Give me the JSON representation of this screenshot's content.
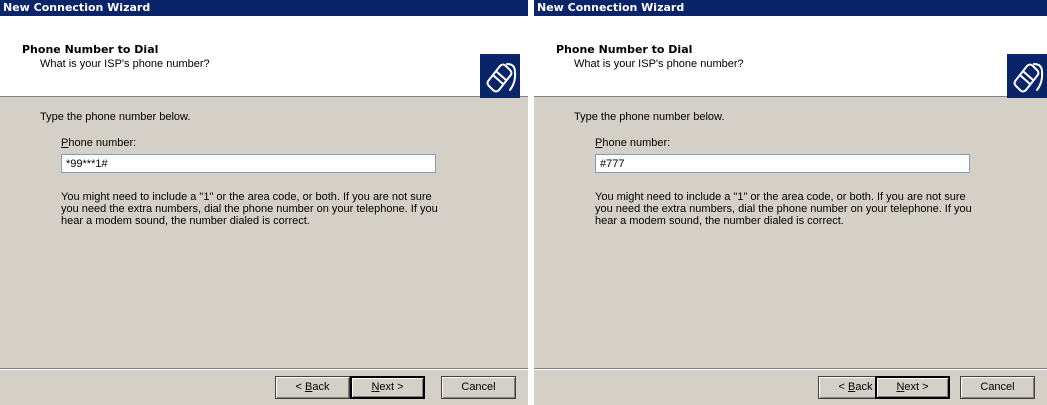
{
  "windows": [
    {
      "title": "New Connection Wizard",
      "header_title": "Phone Number to Dial",
      "header_subtitle": "What is your ISP's phone number?",
      "intro": "Type the phone number below.",
      "phone_label_accel": "P",
      "phone_label_rest": "hone number:",
      "phone_value": "*99***1#",
      "help": "You might need to include a \"1\" or the area code, or both. If you are not sure you need the extra numbers, dial the phone number on your telephone. If you hear a modem sound, the number dialed is correct.",
      "buttons": {
        "back_prefix": "< ",
        "back_accel": "B",
        "back_rest": "ack",
        "next_accel": "N",
        "next_rest": "ext >",
        "cancel": "Cancel"
      },
      "icon": "phone-handset-icon"
    },
    {
      "title": "New Connection Wizard",
      "header_title": "Phone Number to Dial",
      "header_subtitle": "What is your ISP's phone number?",
      "intro": "Type the phone number below.",
      "phone_label_accel": "P",
      "phone_label_rest": "hone number:",
      "phone_value": "#777",
      "help": "You might need to include a \"1\" or the area code, or both. If you are not sure you need the extra numbers, dial the phone number on your telephone. If you hear a modem sound, the number dialed is correct.",
      "buttons": {
        "back_prefix": "< ",
        "back_accel": "B",
        "back_rest": "ack",
        "next_accel": "N",
        "next_rest": "ext >",
        "cancel": "Cancel"
      },
      "icon": "phone-handset-icon"
    }
  ],
  "colors": {
    "titlebar": "#0a246a",
    "dialog_face": "#d4d0c8",
    "header_bg": "#ffffff",
    "icon_bg": "#0a246a"
  }
}
